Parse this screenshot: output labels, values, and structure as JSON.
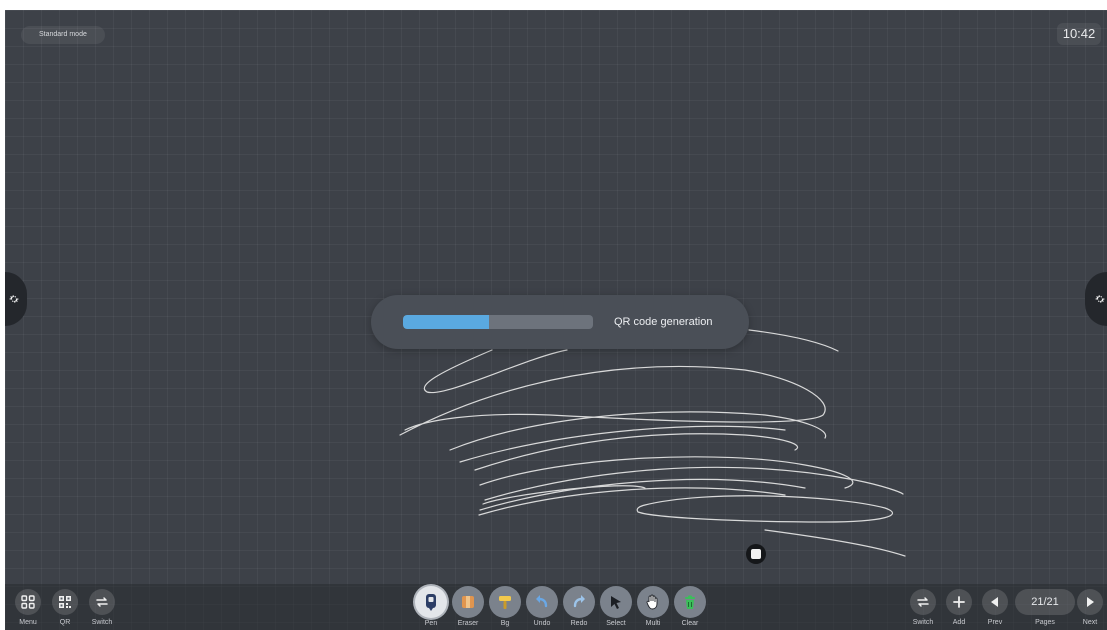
{
  "top": {
    "mode": "Standard mode",
    "clock": "10:42"
  },
  "progress": {
    "label": "QR code generation",
    "value": 0.45,
    "fill_color": "#5aa9e0"
  },
  "left_tools": [
    {
      "label": "Menu",
      "icon": "menu-grid-icon"
    },
    {
      "label": "QR",
      "icon": "qr-code-icon"
    },
    {
      "label": "Switch",
      "icon": "switch-icon"
    }
  ],
  "center_tools": [
    {
      "label": "Pen",
      "icon": "pen-icon",
      "active": true
    },
    {
      "label": "Eraser",
      "icon": "eraser-icon"
    },
    {
      "label": "Bg",
      "icon": "background-brush-icon"
    },
    {
      "label": "Undo",
      "icon": "undo-icon"
    },
    {
      "label": "Redo",
      "icon": "redo-icon"
    },
    {
      "label": "Select",
      "icon": "select-cursor-icon"
    },
    {
      "label": "Multi",
      "icon": "multi-touch-icon"
    },
    {
      "label": "Clear",
      "icon": "trash-icon"
    }
  ],
  "right_tools": [
    {
      "label": "Switch",
      "icon": "switch-icon"
    },
    {
      "label": "Add",
      "icon": "add-icon"
    },
    {
      "label": "Prev",
      "icon": "prev-icon"
    },
    {
      "label": "Pages",
      "icon": "pages-counter"
    },
    {
      "label": "Next",
      "icon": "next-icon"
    }
  ],
  "pages": {
    "current": "21/21"
  },
  "colors": {
    "board": "#3d4148",
    "accent": "#5aa9e0",
    "stroke": "#e6e6e6"
  }
}
